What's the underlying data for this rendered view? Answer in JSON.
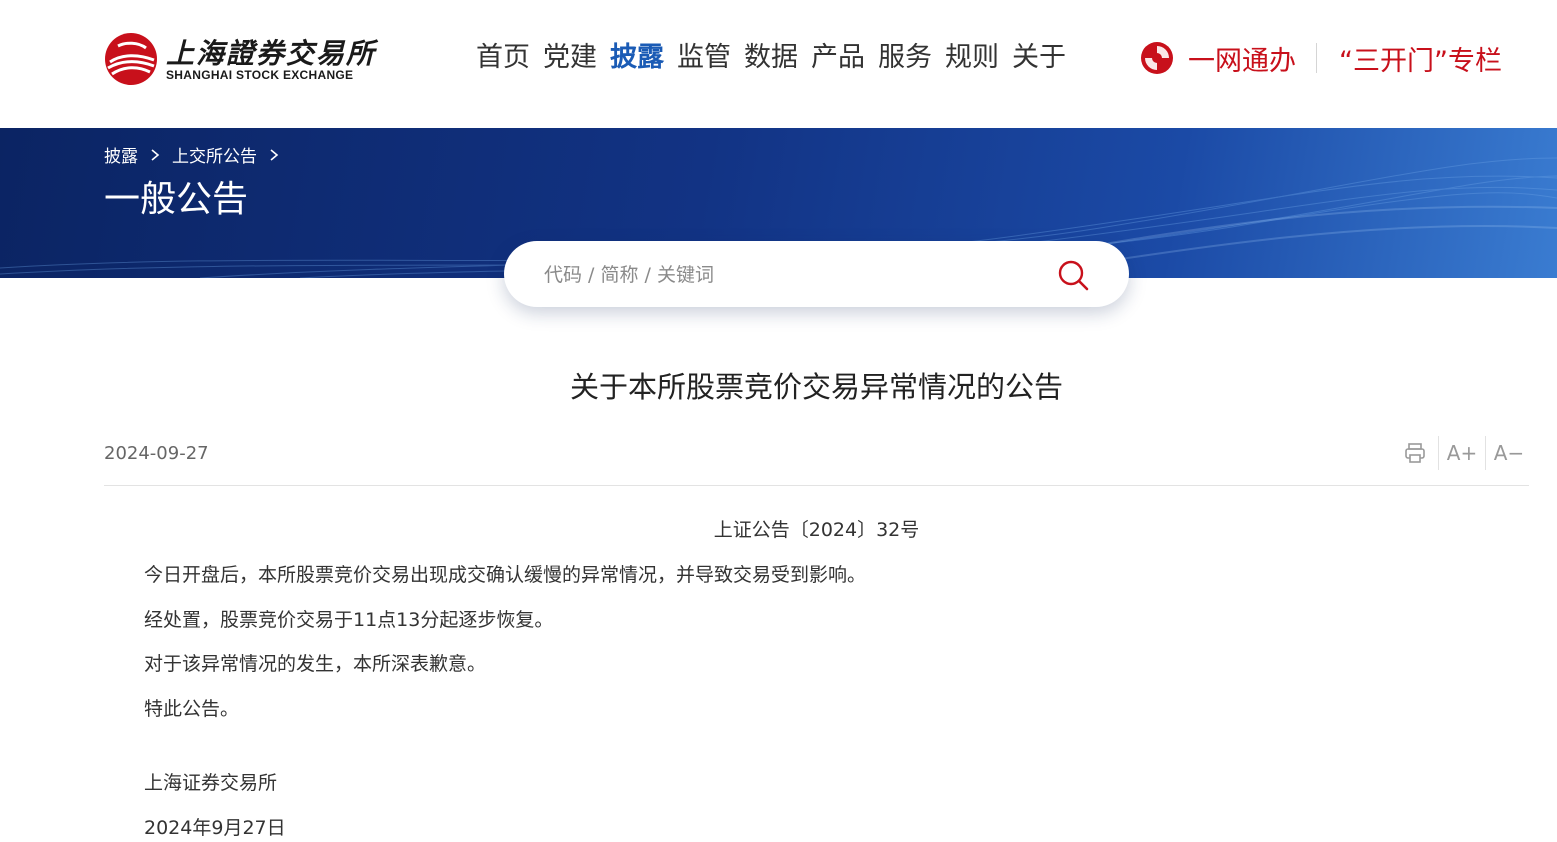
{
  "header": {
    "logo_cn": "上海證券交易所",
    "logo_en": "SHANGHAI STOCK EXCHANGE",
    "nav": [
      "首页",
      "党建",
      "披露",
      "监管",
      "数据",
      "产品",
      "服务",
      "规则",
      "关于"
    ],
    "active_nav": "披露",
    "quick_links": [
      "一网通办",
      "“三开门”专栏"
    ]
  },
  "banner": {
    "breadcrumb": [
      "披露",
      "上交所公告"
    ],
    "title": "一般公告"
  },
  "search": {
    "placeholder": "代码 / 简称 / 关键词"
  },
  "article": {
    "title": "关于本所股票竞价交易异常情况的公告",
    "date": "2024-09-27",
    "tools": {
      "font_increase": "A+",
      "font_decrease": "A−"
    },
    "doc_number": "上证公告〔2024〕32号",
    "paragraphs": [
      "今日开盘后，本所股票竞价交易出现成交确认缓慢的异常情况，并导致交易受到影响。",
      "经处置，股票竞价交易于11点13分起逐步恢复。",
      "对于该异常情况的发生，本所深表歉意。",
      "特此公告。"
    ],
    "signature": "上海证券交易所",
    "sign_date": "2024年9月27日"
  },
  "colors": {
    "brand_red": "#c8101b",
    "nav_active": "#1a5bb5",
    "banner_dark": "#0b2463"
  }
}
